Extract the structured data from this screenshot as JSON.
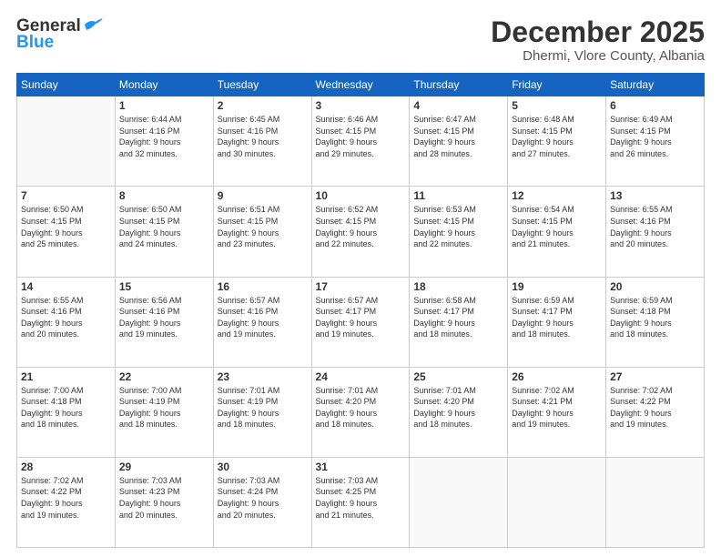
{
  "header": {
    "logo_general": "General",
    "logo_blue": "Blue",
    "month": "December 2025",
    "location": "Dhermi, Vlore County, Albania"
  },
  "weekdays": [
    "Sunday",
    "Monday",
    "Tuesday",
    "Wednesday",
    "Thursday",
    "Friday",
    "Saturday"
  ],
  "weeks": [
    [
      {
        "day": "",
        "info": ""
      },
      {
        "day": "1",
        "info": "Sunrise: 6:44 AM\nSunset: 4:16 PM\nDaylight: 9 hours\nand 32 minutes."
      },
      {
        "day": "2",
        "info": "Sunrise: 6:45 AM\nSunset: 4:16 PM\nDaylight: 9 hours\nand 30 minutes."
      },
      {
        "day": "3",
        "info": "Sunrise: 6:46 AM\nSunset: 4:15 PM\nDaylight: 9 hours\nand 29 minutes."
      },
      {
        "day": "4",
        "info": "Sunrise: 6:47 AM\nSunset: 4:15 PM\nDaylight: 9 hours\nand 28 minutes."
      },
      {
        "day": "5",
        "info": "Sunrise: 6:48 AM\nSunset: 4:15 PM\nDaylight: 9 hours\nand 27 minutes."
      },
      {
        "day": "6",
        "info": "Sunrise: 6:49 AM\nSunset: 4:15 PM\nDaylight: 9 hours\nand 26 minutes."
      }
    ],
    [
      {
        "day": "7",
        "info": "Sunrise: 6:50 AM\nSunset: 4:15 PM\nDaylight: 9 hours\nand 25 minutes."
      },
      {
        "day": "8",
        "info": "Sunrise: 6:50 AM\nSunset: 4:15 PM\nDaylight: 9 hours\nand 24 minutes."
      },
      {
        "day": "9",
        "info": "Sunrise: 6:51 AM\nSunset: 4:15 PM\nDaylight: 9 hours\nand 23 minutes."
      },
      {
        "day": "10",
        "info": "Sunrise: 6:52 AM\nSunset: 4:15 PM\nDaylight: 9 hours\nand 22 minutes."
      },
      {
        "day": "11",
        "info": "Sunrise: 6:53 AM\nSunset: 4:15 PM\nDaylight: 9 hours\nand 22 minutes."
      },
      {
        "day": "12",
        "info": "Sunrise: 6:54 AM\nSunset: 4:15 PM\nDaylight: 9 hours\nand 21 minutes."
      },
      {
        "day": "13",
        "info": "Sunrise: 6:55 AM\nSunset: 4:16 PM\nDaylight: 9 hours\nand 20 minutes."
      }
    ],
    [
      {
        "day": "14",
        "info": "Sunrise: 6:55 AM\nSunset: 4:16 PM\nDaylight: 9 hours\nand 20 minutes."
      },
      {
        "day": "15",
        "info": "Sunrise: 6:56 AM\nSunset: 4:16 PM\nDaylight: 9 hours\nand 19 minutes."
      },
      {
        "day": "16",
        "info": "Sunrise: 6:57 AM\nSunset: 4:16 PM\nDaylight: 9 hours\nand 19 minutes."
      },
      {
        "day": "17",
        "info": "Sunrise: 6:57 AM\nSunset: 4:17 PM\nDaylight: 9 hours\nand 19 minutes."
      },
      {
        "day": "18",
        "info": "Sunrise: 6:58 AM\nSunset: 4:17 PM\nDaylight: 9 hours\nand 18 minutes."
      },
      {
        "day": "19",
        "info": "Sunrise: 6:59 AM\nSunset: 4:17 PM\nDaylight: 9 hours\nand 18 minutes."
      },
      {
        "day": "20",
        "info": "Sunrise: 6:59 AM\nSunset: 4:18 PM\nDaylight: 9 hours\nand 18 minutes."
      }
    ],
    [
      {
        "day": "21",
        "info": "Sunrise: 7:00 AM\nSunset: 4:18 PM\nDaylight: 9 hours\nand 18 minutes."
      },
      {
        "day": "22",
        "info": "Sunrise: 7:00 AM\nSunset: 4:19 PM\nDaylight: 9 hours\nand 18 minutes."
      },
      {
        "day": "23",
        "info": "Sunrise: 7:01 AM\nSunset: 4:19 PM\nDaylight: 9 hours\nand 18 minutes."
      },
      {
        "day": "24",
        "info": "Sunrise: 7:01 AM\nSunset: 4:20 PM\nDaylight: 9 hours\nand 18 minutes."
      },
      {
        "day": "25",
        "info": "Sunrise: 7:01 AM\nSunset: 4:20 PM\nDaylight: 9 hours\nand 18 minutes."
      },
      {
        "day": "26",
        "info": "Sunrise: 7:02 AM\nSunset: 4:21 PM\nDaylight: 9 hours\nand 19 minutes."
      },
      {
        "day": "27",
        "info": "Sunrise: 7:02 AM\nSunset: 4:22 PM\nDaylight: 9 hours\nand 19 minutes."
      }
    ],
    [
      {
        "day": "28",
        "info": "Sunrise: 7:02 AM\nSunset: 4:22 PM\nDaylight: 9 hours\nand 19 minutes."
      },
      {
        "day": "29",
        "info": "Sunrise: 7:03 AM\nSunset: 4:23 PM\nDaylight: 9 hours\nand 20 minutes."
      },
      {
        "day": "30",
        "info": "Sunrise: 7:03 AM\nSunset: 4:24 PM\nDaylight: 9 hours\nand 20 minutes."
      },
      {
        "day": "31",
        "info": "Sunrise: 7:03 AM\nSunset: 4:25 PM\nDaylight: 9 hours\nand 21 minutes."
      },
      {
        "day": "",
        "info": ""
      },
      {
        "day": "",
        "info": ""
      },
      {
        "day": "",
        "info": ""
      }
    ]
  ]
}
